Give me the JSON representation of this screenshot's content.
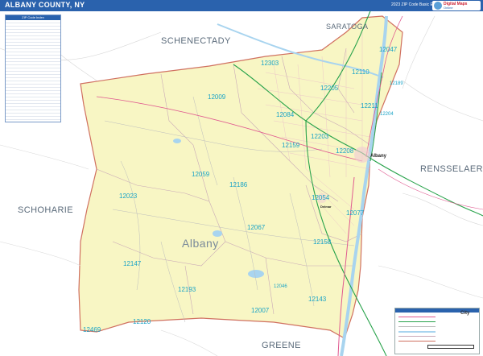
{
  "header": {
    "title": "ALBANY COUNTY, NY",
    "edition": "2023 ZIP Code Basic Edition",
    "logo_text": "Digital Maps",
    "logo_sub": "Online"
  },
  "counties": {
    "schenectady": "SCHENECTADY",
    "saratoga": "SARATOGA",
    "rensselaer": "RENSSELAER",
    "schoharie": "SCHOHARIE",
    "greene": "GREENE",
    "albany": "Albany"
  },
  "zip_labels": {
    "z12303": "12303",
    "z12047": "12047",
    "z12110": "12110",
    "z12189": "12189",
    "z12205": "12205",
    "z12009": "12009",
    "z12211": "12211",
    "z12084": "12084",
    "z12204": "12204",
    "z12203": "12203",
    "z12159": "12159",
    "z12208": "12208",
    "z12059": "12059",
    "z12186": "12186",
    "z12023": "12023",
    "z12054": "12054",
    "z12077": "12077",
    "z12067": "12067",
    "z12158": "12158",
    "z12147": "12147",
    "z12193": "12193",
    "z12046": "12046",
    "z12143": "12143",
    "z12007": "12007",
    "z12120": "12120",
    "z12469": "12469"
  },
  "city_labels": {
    "albany": "Albany",
    "delmar": "Delmar"
  },
  "index_table": {
    "title": "ZIP Code Index"
  },
  "legend": {
    "title": "City"
  },
  "colors": {
    "county_fill": "#f8f6c4",
    "header_bg": "#2a62ad",
    "zip_label": "#19a3c6",
    "water": "#a8d4ef",
    "interstate": "#27a24a",
    "us_highway": "#e05a90",
    "state_road": "#b0b0b0",
    "outside": "#ffffff"
  },
  "icons": [
    "north-arrow-icon"
  ]
}
